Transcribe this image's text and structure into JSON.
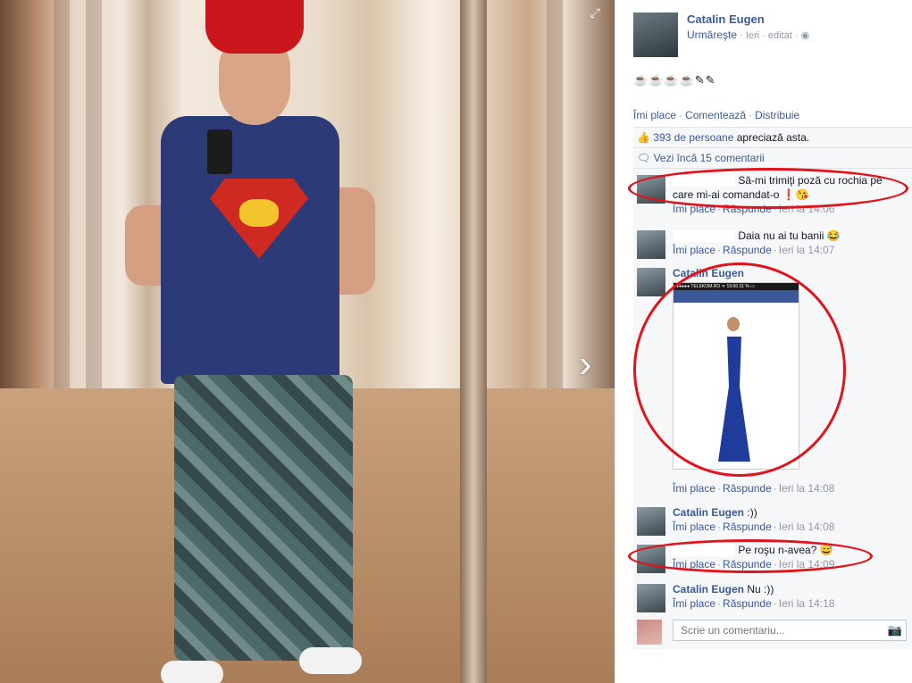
{
  "owner": {
    "name": "Catalin Eugen",
    "follow": "Urmăreşte",
    "time": "Ieri",
    "edited": "editat",
    "privacy_icon": "globe-icon"
  },
  "post_text": "☕☕☕☕✎✎",
  "actions": {
    "like": "Îmi place",
    "comment": "Comentează",
    "share": "Distribuie"
  },
  "likes": {
    "count": "393 de persoane",
    "suffix": "apreciază asta."
  },
  "more_comments": "Vezi încă 15 comentarii",
  "comments": [
    {
      "name": "",
      "text": "Să-mi trimiţi poză cu rochia pe care mi-ai comandat-o ❗😘",
      "like": "Îmi place",
      "reply": "Răspunde",
      "time": "Ieri la 14:06"
    },
    {
      "name": "",
      "text": "Daia nu ai tu banii 😂",
      "like": "Îmi place",
      "reply": "Răspunde",
      "time": "Ieri la 14:07"
    },
    {
      "name": "Catalin Eugen",
      "text": "",
      "like": "Îmi place",
      "reply": "Răspunde",
      "time": "Ieri la 14:08"
    },
    {
      "name": "Catalin Eugen",
      "text": ":))",
      "like": "Îmi place",
      "reply": "Răspunde",
      "time": "Ieri la 14:08"
    },
    {
      "name": "",
      "text": "Pe roşu n-avea? 😅",
      "like": "Îmi place",
      "reply": "Răspunde",
      "time": "Ieri la 14:09"
    },
    {
      "name": "Catalin Eugen",
      "text": "Nu :))",
      "like": "Îmi place",
      "reply": "Răspunde",
      "time": "Ieri la 14:18"
    }
  ],
  "attachment": {
    "status_bar": "●●●●● TELEKOM.RO ᯤ 19:56  31 % ▭"
  },
  "write_comment": {
    "placeholder": "Scrie un comentariu..."
  },
  "colors": {
    "link": "#3b5998",
    "highlight": "#e0141c",
    "panel_bg": "#f6f7f8"
  }
}
